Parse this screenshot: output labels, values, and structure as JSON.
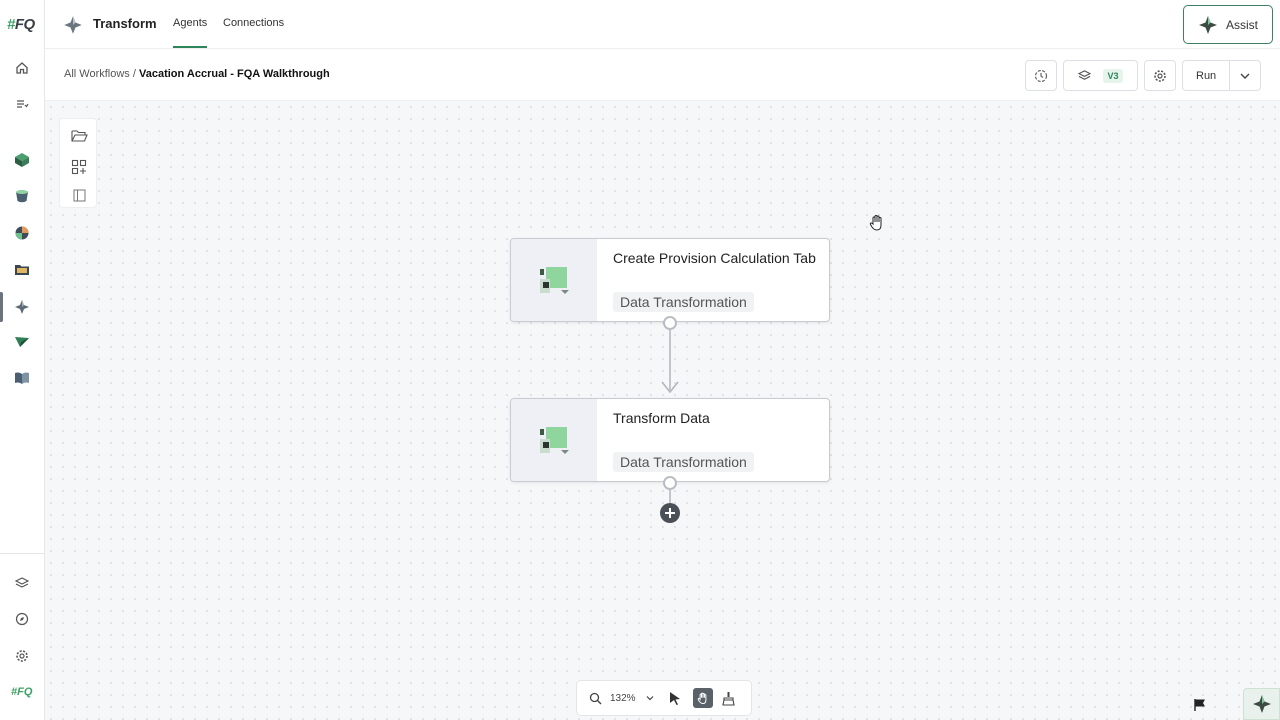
{
  "app": {
    "logo_text": "FQ",
    "logo_hash": "#",
    "title": "Transform",
    "tabs": [
      {
        "label": "Agents",
        "active": true
      },
      {
        "label": "Connections",
        "active": false
      }
    ],
    "assist_label": "Assist"
  },
  "rail": {
    "items": [
      "home-icon",
      "tasks-icon",
      "cube-icon",
      "bucket-icon",
      "sync-icon",
      "folder-icon",
      "transform-icon",
      "send-icon",
      "book-icon"
    ],
    "bottom": [
      "layers-icon",
      "compass-icon",
      "gear-icon"
    ],
    "bottom_logo": "#FQ"
  },
  "breadcrumb": {
    "root": "All Workflows",
    "separator": "/",
    "current": "Vacation Accrual - FQA Walkthrough"
  },
  "toolbar": {
    "version": "V3",
    "run_label": "Run"
  },
  "nodes": [
    {
      "title": "Create Provision Calculation Tab",
      "type": "Data Transformation"
    },
    {
      "title": "Transform Data",
      "type": "Data Transformation"
    }
  ],
  "zoom": {
    "value": "132%"
  },
  "colors": {
    "accent": "#2f855a",
    "node_icon_green": "#7fcf8f",
    "node_icon_dark": "#2f3a33"
  }
}
